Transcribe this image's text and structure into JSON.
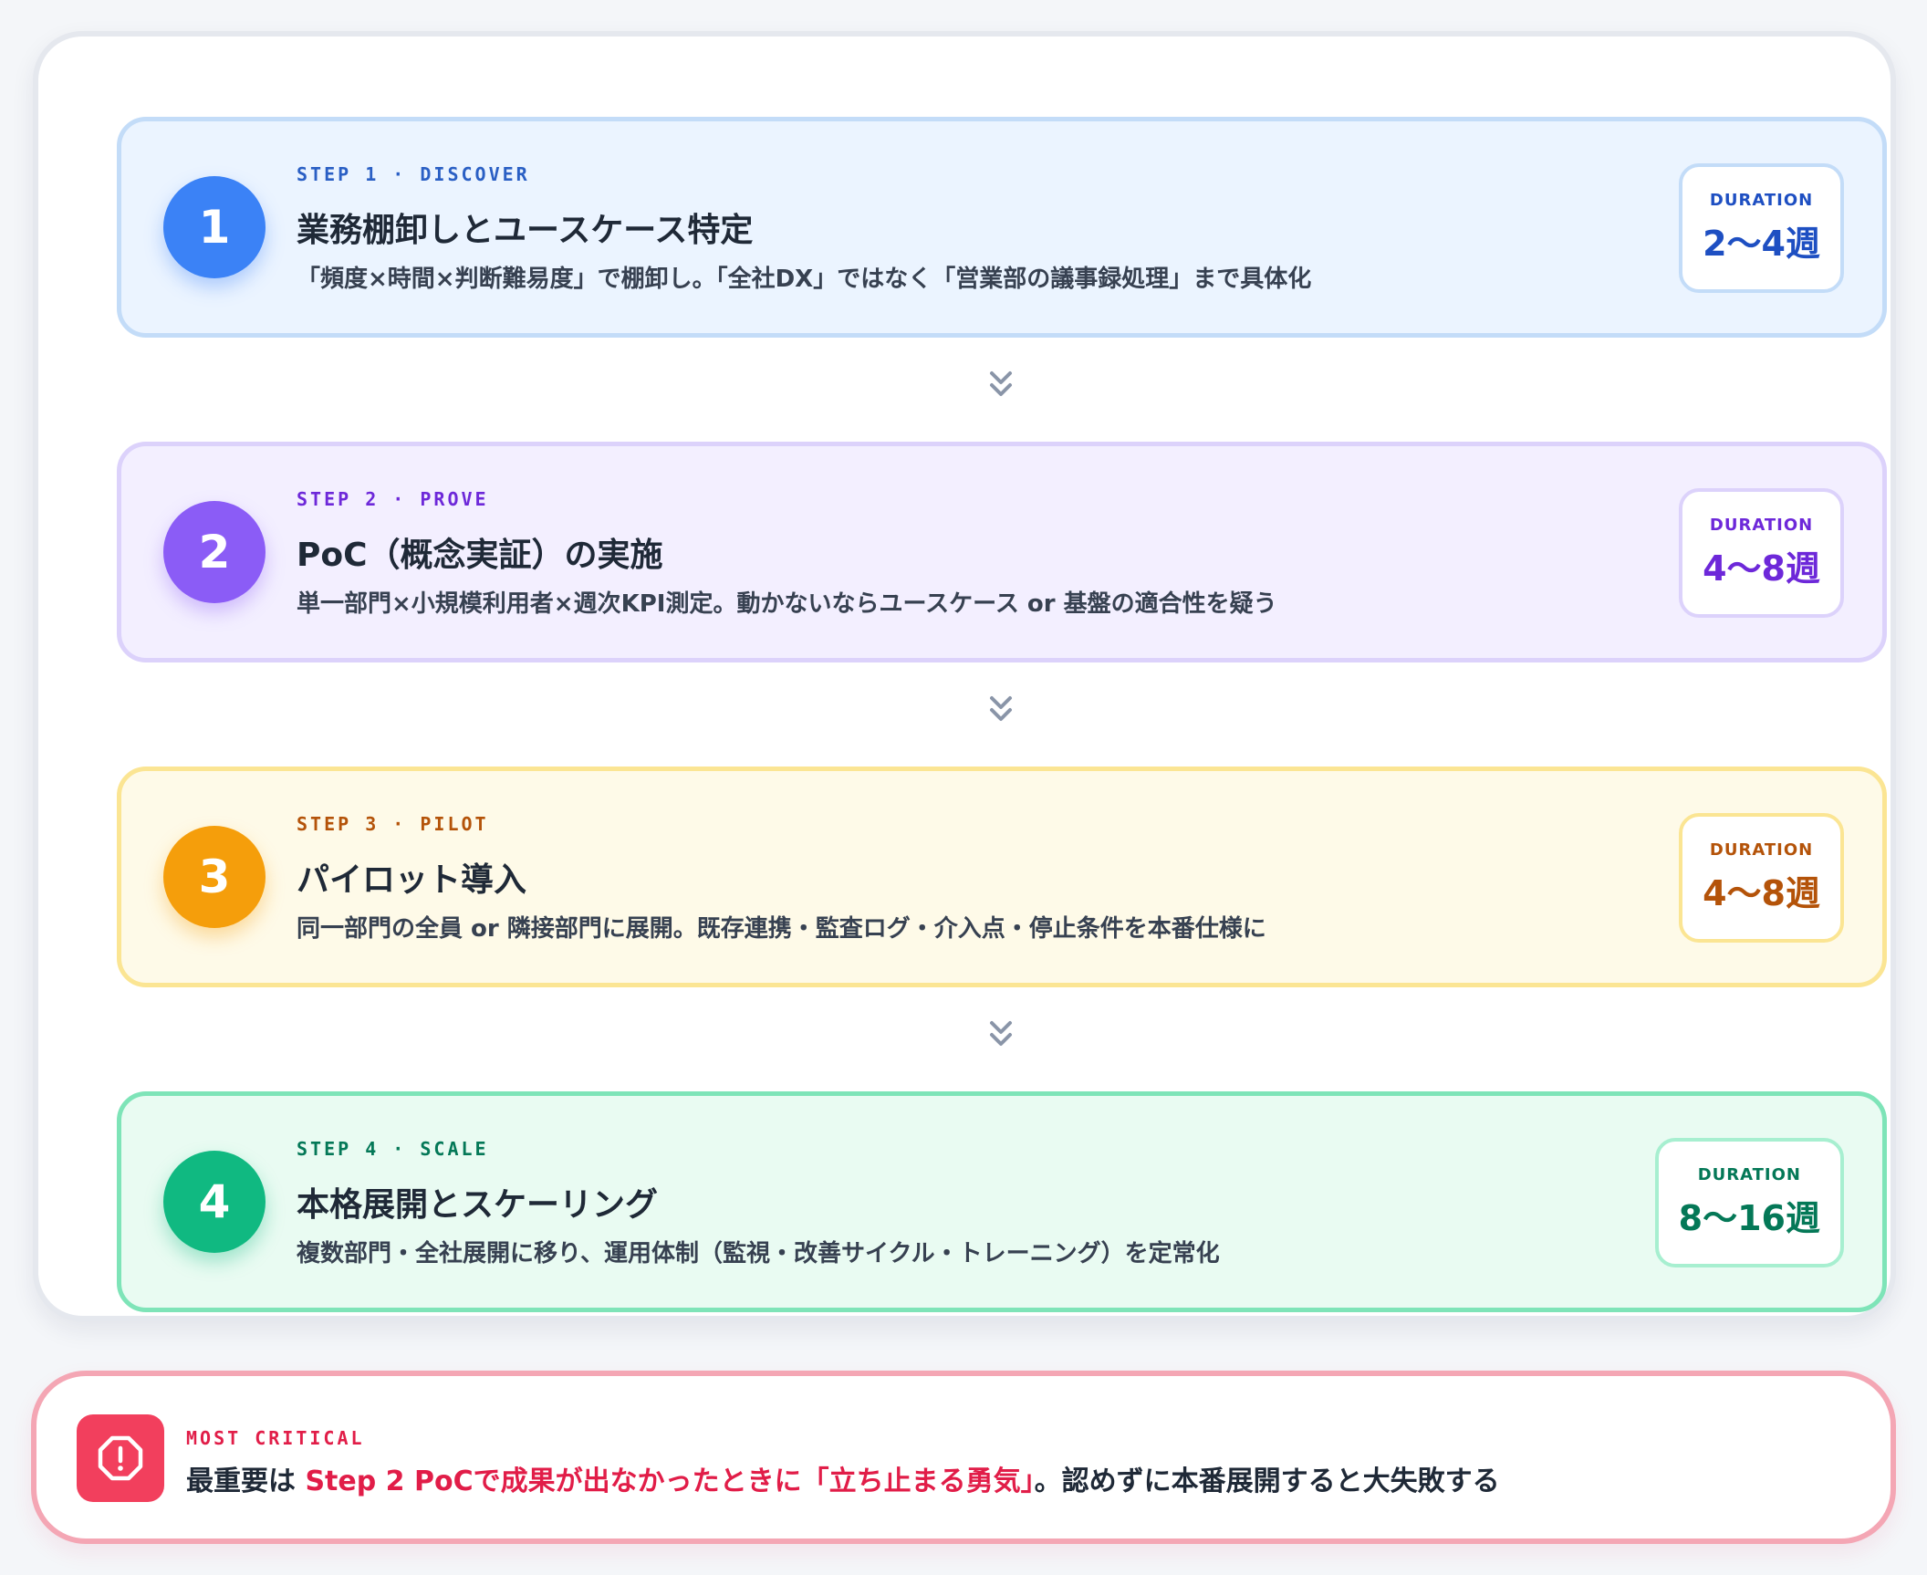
{
  "steps": [
    {
      "number": "1",
      "eyebrow": "STEP 1 · DISCOVER",
      "title": "業務棚卸しとユースケース特定",
      "description": "「頻度×時間×判断難易度」で棚卸し。「全社DX」ではなく「営業部の議事録処理」まで具体化",
      "duration_label": "DURATION",
      "duration_value": "2〜4週",
      "accent": "#3b82f6"
    },
    {
      "number": "2",
      "eyebrow": "STEP 2 · PROVE",
      "title": "PoC（概念実証）の実施",
      "description": "単一部門×小規模利用者×週次KPI測定。動かないならユースケース or 基盤の適合性を疑う",
      "duration_label": "DURATION",
      "duration_value": "4〜8週",
      "accent": "#8b5cf6"
    },
    {
      "number": "3",
      "eyebrow": "STEP 3 · PILOT",
      "title": "パイロット導入",
      "description": "同一部門の全員 or 隣接部門に展開。既存連携・監査ログ・介入点・停止条件を本番仕様に",
      "duration_label": "DURATION",
      "duration_value": "4〜8週",
      "accent": "#f59e0b"
    },
    {
      "number": "4",
      "eyebrow": "STEP 4 · SCALE",
      "title": "本格展開とスケーリング",
      "description": "複数部門・全社展開に移り、運用体制（監視・改善サイクル・トレーニング）を定常化",
      "duration_label": "DURATION",
      "duration_value": "8〜16週",
      "accent": "#10b981"
    }
  ],
  "critical": {
    "label": "MOST CRITICAL",
    "text_before": "最重要は ",
    "text_highlight": "Step 2 PoCで成果が出なかったときに「立ち止まる勇気」",
    "text_after": "。認めずに本番展開すると大失敗する",
    "accent": "#e11d48"
  }
}
